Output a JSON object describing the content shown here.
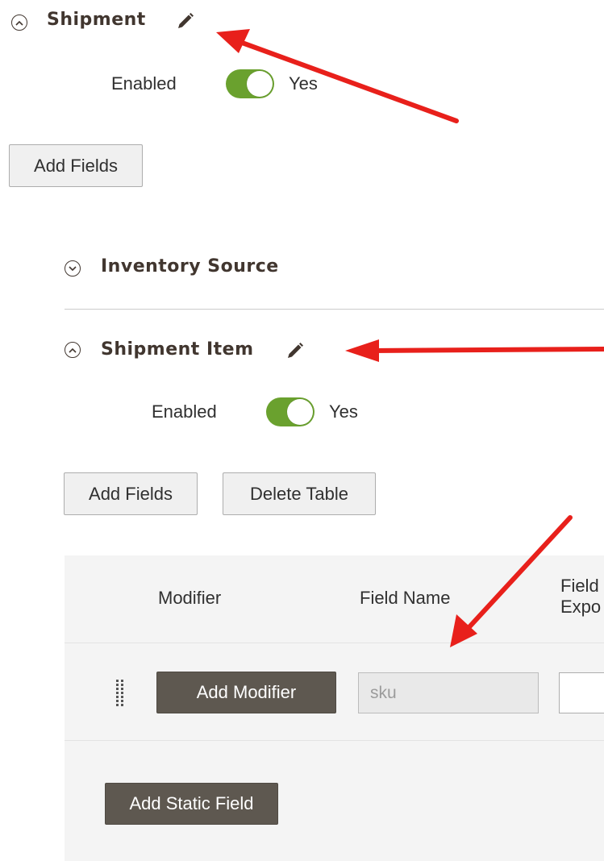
{
  "shipment": {
    "title": "Shipment",
    "enabled_label": "Enabled",
    "enabled_value": "Yes",
    "add_fields_label": "Add Fields"
  },
  "inventory_source": {
    "title": "Inventory Source"
  },
  "shipment_item": {
    "title": "Shipment Item",
    "enabled_label": "Enabled",
    "enabled_value": "Yes",
    "add_fields_label": "Add Fields",
    "delete_table_label": "Delete Table"
  },
  "grid": {
    "headers": {
      "modifier": "Modifier",
      "field_name": "Field Name",
      "field_export_line1": "Field",
      "field_export_line2": "Expo"
    },
    "row": {
      "add_modifier_label": "Add Modifier",
      "field_name_value": "sku"
    },
    "add_static_field_label": "Add Static Field"
  },
  "colors": {
    "toggle_on": "#6aa12e",
    "arrow": "#e8201b",
    "dark_button": "#5e5850",
    "title_text": "#41362f"
  },
  "icons": [
    "chevron-up-icon",
    "chevron-down-icon",
    "pencil-icon",
    "drag-handle-icon",
    "arrow-annotation"
  ]
}
